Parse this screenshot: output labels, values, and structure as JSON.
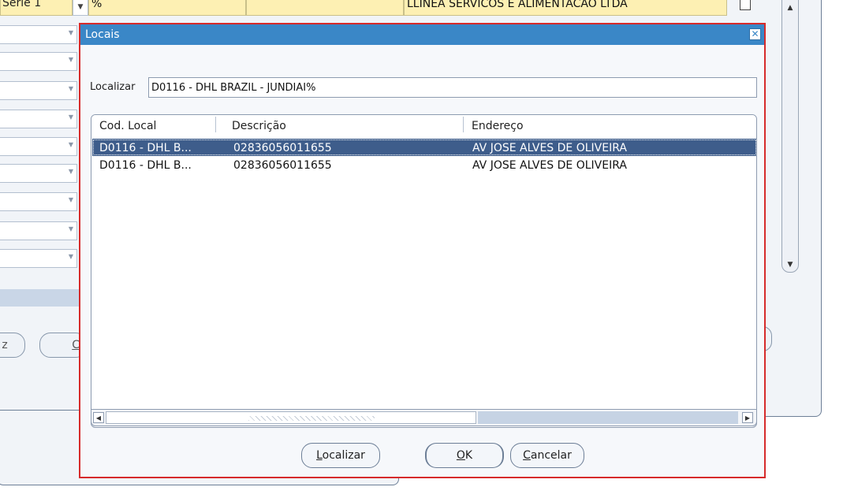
{
  "background": {
    "top_row": {
      "serie_value": "Série 1",
      "filter_value": "%",
      "company_name": "LLINEA SERVICOS E ALIMENTACAO LTDA"
    },
    "left_buttons": [
      {
        "label": "z"
      },
      {
        "label": "C"
      }
    ]
  },
  "dialog": {
    "title": "Locais",
    "search": {
      "label": "Localizar",
      "value": "D0116 - DHL BRAZIL - JUNDIAI%"
    },
    "columns": [
      "Cod. Local",
      "Descrição",
      "Endereço"
    ],
    "rows": [
      {
        "cod_local": "D0116 - DHL B...",
        "descricao": "02836056011655",
        "endereco": "AV JOSE ALVES DE OLIVEIRA",
        "selected": true
      },
      {
        "cod_local": "D0116 - DHL B...",
        "descricao": "02836056011655",
        "endereco": "AV JOSE ALVES DE OLIVEIRA",
        "selected": false
      }
    ],
    "buttons": {
      "find": {
        "mnemonic": "L",
        "rest": "ocalizar"
      },
      "ok": {
        "mnemonic": "O",
        "rest": "K"
      },
      "cancel": {
        "mnemonic": "C",
        "rest": "ancelar"
      }
    }
  },
  "colors": {
    "title_bar": "#3a87c7",
    "selected_row": "#3e5d8b",
    "highlight_border": "#d62b2b",
    "required_field": "#fdf0b3"
  }
}
